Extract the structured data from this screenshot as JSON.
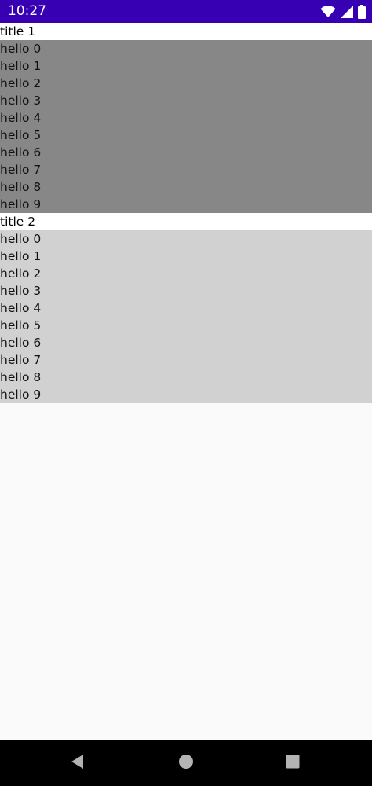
{
  "status_bar": {
    "time": "10:27",
    "icons": [
      "wifi-icon",
      "cellular-signal-icon",
      "battery-icon"
    ],
    "background_color": "#3700b3"
  },
  "sections": [
    {
      "title": "title 1",
      "background_color": "#878787",
      "items": [
        "hello 0",
        "hello 1",
        "hello 2",
        "hello 3",
        "hello 4",
        "hello 5",
        "hello 6",
        "hello 7",
        "hello 8",
        "hello 9"
      ]
    },
    {
      "title": "title 2",
      "background_color": "#d1d1d1",
      "items": [
        "hello 0",
        "hello 1",
        "hello 2",
        "hello 3",
        "hello 4",
        "hello 5",
        "hello 6",
        "hello 7",
        "hello 8",
        "hello 9"
      ]
    }
  ],
  "nav_bar": {
    "buttons": [
      "back-icon",
      "home-icon",
      "recents-icon"
    ]
  }
}
